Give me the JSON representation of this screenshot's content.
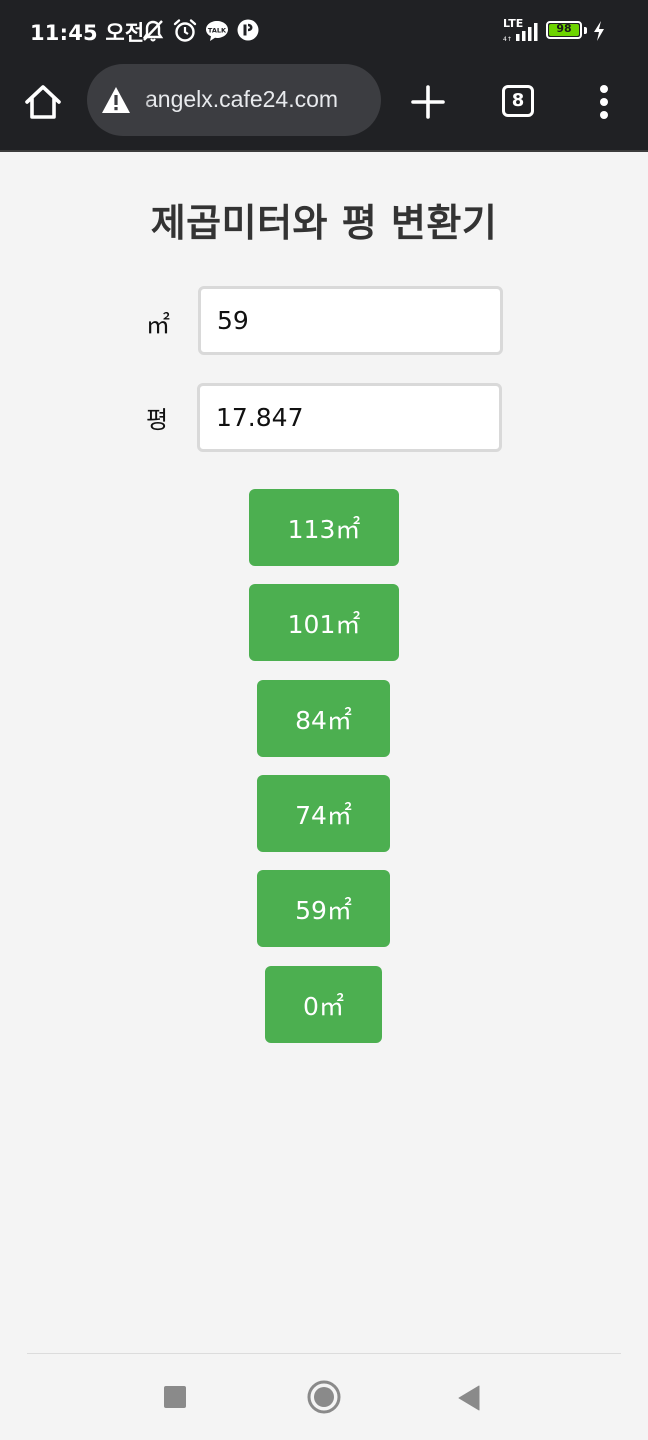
{
  "status_bar": {
    "time": "11:45 오전",
    "network": "LTE",
    "battery": "98"
  },
  "browser": {
    "url": "angelx.cafe24.com",
    "tab_count": "8"
  },
  "converter": {
    "title": "제곱미터와 평 변환기",
    "sqm_label": "㎡",
    "sqm_value": "59",
    "pyeong_label": "평",
    "pyeong_value": "17.847",
    "presets": [
      "113㎡",
      "101㎡",
      "84㎡",
      "74㎡",
      "59㎡",
      "0㎡"
    ]
  },
  "colors": {
    "button_green": "#4caf50",
    "browser_chrome": "#202124",
    "page_background": "#f4f4f4"
  },
  "icons": {
    "status": [
      "mute-notifications-icon",
      "alarm-icon",
      "talk-icon",
      "app-notification-icon",
      "signal-icon",
      "charging-icon"
    ],
    "toolbar": [
      "home-icon",
      "warning-icon",
      "plus-icon",
      "tabs-icon",
      "more-vert-icon"
    ],
    "navigation": [
      "recents-icon",
      "home-circle-icon",
      "back-icon"
    ]
  }
}
